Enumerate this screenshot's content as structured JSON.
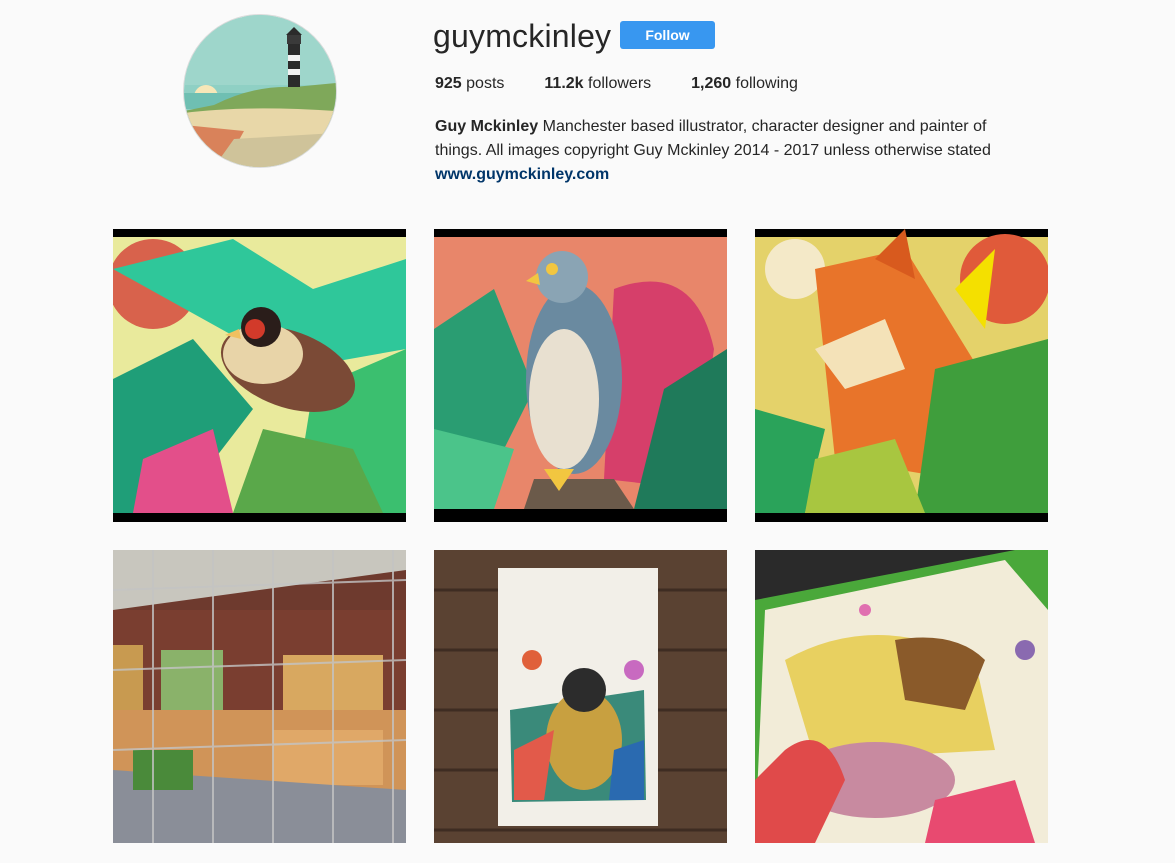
{
  "profile": {
    "username": "guymckinley",
    "follow_label": "Follow",
    "avatar_icon": "lighthouse-avatar",
    "posts_count": "925",
    "posts_label": "posts",
    "followers_count": "11.2k",
    "followers_label": "followers",
    "following_count": "1,260",
    "following_label": "following",
    "full_name": "Guy Mckinley",
    "bio_text": "Manchester based illustrator, character designer and painter of things. All images copyright Guy Mckinley 2014 - 2017 unless otherwise stated",
    "website": "www.guymckinley.com"
  },
  "colors": {
    "follow_button": "#3897f0",
    "link": "#003569",
    "background": "#fafafa"
  }
}
